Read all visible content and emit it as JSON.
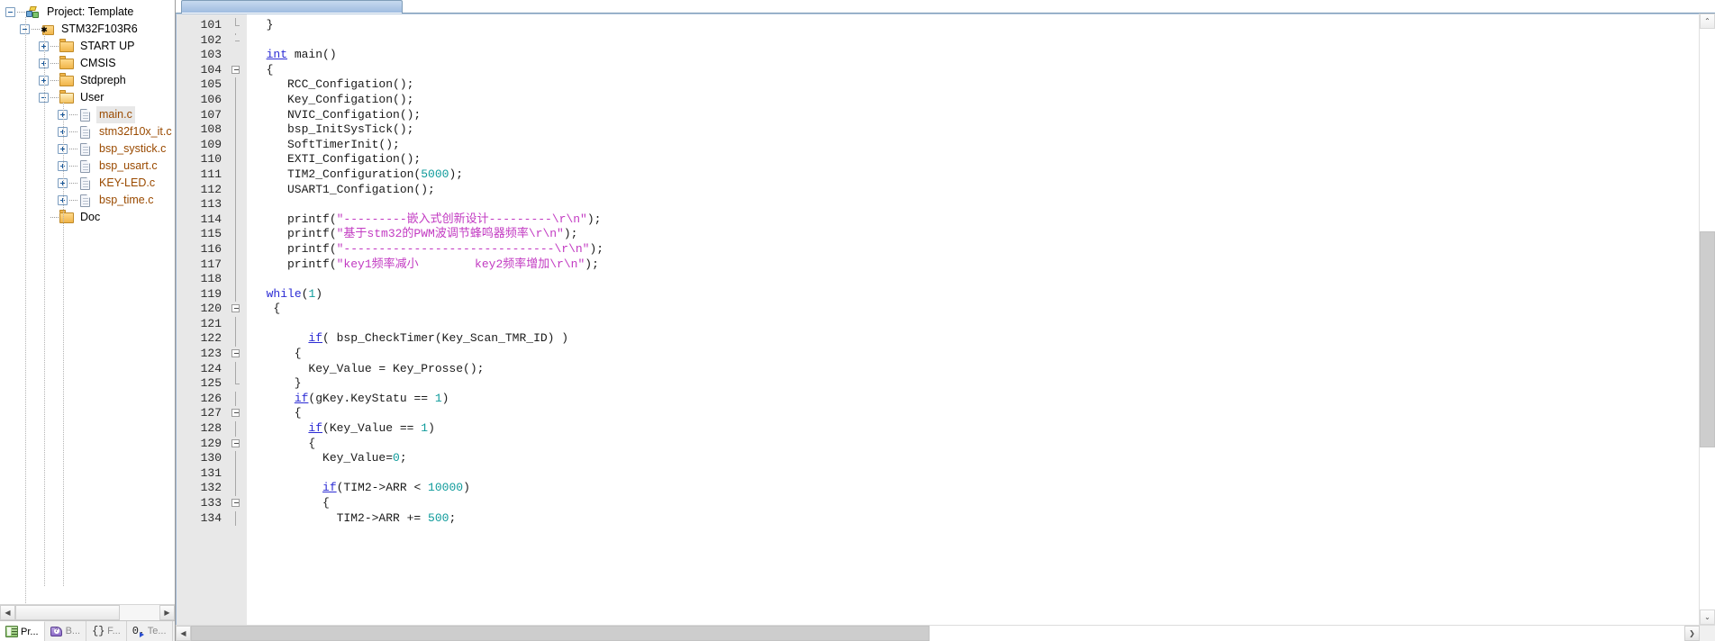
{
  "project_pane": {
    "tree": [
      {
        "depth": 0,
        "type": "project",
        "label": "Project: Template",
        "expander": "minus",
        "selected": false
      },
      {
        "depth": 1,
        "type": "target",
        "label": "STM32F103R6",
        "expander": "minus",
        "selected": false
      },
      {
        "depth": 2,
        "type": "folder",
        "label": "START UP",
        "expander": "plus",
        "selected": false
      },
      {
        "depth": 2,
        "type": "folder",
        "label": "CMSIS",
        "expander": "plus",
        "selected": false
      },
      {
        "depth": 2,
        "type": "folder",
        "label": "Stdpreph",
        "expander": "plus",
        "selected": false
      },
      {
        "depth": 2,
        "type": "folder-open",
        "label": "User",
        "expander": "minus",
        "selected": false
      },
      {
        "depth": 3,
        "type": "file",
        "label": "main.c",
        "expander": "plus",
        "selected": true
      },
      {
        "depth": 3,
        "type": "file",
        "label": "stm32f10x_it.c",
        "expander": "plus",
        "selected": false
      },
      {
        "depth": 3,
        "type": "file",
        "label": "bsp_systick.c",
        "expander": "plus",
        "selected": false
      },
      {
        "depth": 3,
        "type": "file",
        "label": "bsp_usart.c",
        "expander": "plus",
        "selected": false
      },
      {
        "depth": 3,
        "type": "file",
        "label": "KEY-LED.c",
        "expander": "plus",
        "selected": false
      },
      {
        "depth": 3,
        "type": "file",
        "label": "bsp_time.c",
        "expander": "plus",
        "selected": false
      },
      {
        "depth": 2,
        "type": "folder",
        "label": "Doc",
        "expander": "none",
        "selected": false
      }
    ],
    "hscroll": {
      "left_arrow": "◀",
      "right_arrow": "▶"
    },
    "tabs": [
      {
        "label": "Pr...",
        "icon": "project-window-icon",
        "active": true
      },
      {
        "label": "B...",
        "icon": "books-icon",
        "active": false
      },
      {
        "label": "F...",
        "icon": "functions-icon",
        "active": false
      },
      {
        "label": "Te...",
        "icon": "templates-icon",
        "active": false
      }
    ]
  },
  "editor": {
    "first_line": 101,
    "scrollbars": {
      "up_arrow": "⌃",
      "down_arrow": "⌄",
      "right_arrow": "❯"
    },
    "lines": [
      {
        "n": 101,
        "fold": "end",
        "tokens": [
          {
            "t": "  }",
            "c": "plain"
          }
        ]
      },
      {
        "n": 102,
        "fold": "tail",
        "tokens": []
      },
      {
        "n": 103,
        "fold": "none",
        "tokens": [
          {
            "t": "  ",
            "c": "plain"
          },
          {
            "t": "int",
            "c": "kwu"
          },
          {
            "t": " main()",
            "c": "plain"
          }
        ]
      },
      {
        "n": 104,
        "fold": "box",
        "tokens": [
          {
            "t": "  {",
            "c": "plain"
          }
        ]
      },
      {
        "n": 105,
        "fold": "line",
        "tokens": [
          {
            "t": "     RCC_Configation();",
            "c": "plain"
          }
        ]
      },
      {
        "n": 106,
        "fold": "line",
        "tokens": [
          {
            "t": "     Key_Configation();",
            "c": "plain"
          }
        ]
      },
      {
        "n": 107,
        "fold": "line",
        "tokens": [
          {
            "t": "     NVIC_Configation();",
            "c": "plain"
          }
        ]
      },
      {
        "n": 108,
        "fold": "line",
        "tokens": [
          {
            "t": "     bsp_InitSysTick();",
            "c": "plain"
          }
        ]
      },
      {
        "n": 109,
        "fold": "line",
        "tokens": [
          {
            "t": "     SoftTimerInit();",
            "c": "plain"
          }
        ]
      },
      {
        "n": 110,
        "fold": "line",
        "tokens": [
          {
            "t": "     EXTI_Configation();",
            "c": "plain"
          }
        ]
      },
      {
        "n": 111,
        "fold": "line",
        "tokens": [
          {
            "t": "     TIM2_Configuration(",
            "c": "plain"
          },
          {
            "t": "5000",
            "c": "num"
          },
          {
            "t": ");",
            "c": "plain"
          }
        ]
      },
      {
        "n": 112,
        "fold": "line",
        "tokens": [
          {
            "t": "     USART1_Configation();",
            "c": "plain"
          }
        ]
      },
      {
        "n": 113,
        "fold": "line",
        "tokens": []
      },
      {
        "n": 114,
        "fold": "line",
        "tokens": [
          {
            "t": "     printf(",
            "c": "plain"
          },
          {
            "t": "\"---------嵌入式创新设计---------\\r\\n\"",
            "c": "str"
          },
          {
            "t": ");",
            "c": "plain"
          }
        ]
      },
      {
        "n": 115,
        "fold": "line",
        "tokens": [
          {
            "t": "     printf(",
            "c": "plain"
          },
          {
            "t": "\"基于stm32的PWM波调节蜂鸣器频率\\r\\n\"",
            "c": "str"
          },
          {
            "t": ");",
            "c": "plain"
          }
        ]
      },
      {
        "n": 116,
        "fold": "line",
        "tokens": [
          {
            "t": "     printf(",
            "c": "plain"
          },
          {
            "t": "\"------------------------------\\r\\n\"",
            "c": "str"
          },
          {
            "t": ");",
            "c": "plain"
          }
        ]
      },
      {
        "n": 117,
        "fold": "line",
        "tokens": [
          {
            "t": "     printf(",
            "c": "plain"
          },
          {
            "t": "\"key1频率减小        key2频率增加\\r\\n\"",
            "c": "str"
          },
          {
            "t": ");",
            "c": "plain"
          }
        ]
      },
      {
        "n": 118,
        "fold": "line",
        "tokens": []
      },
      {
        "n": 119,
        "fold": "line",
        "tokens": [
          {
            "t": "  ",
            "c": "plain"
          },
          {
            "t": "while",
            "c": "kw"
          },
          {
            "t": "(",
            "c": "plain"
          },
          {
            "t": "1",
            "c": "num"
          },
          {
            "t": ")",
            "c": "plain"
          }
        ]
      },
      {
        "n": 120,
        "fold": "box",
        "tokens": [
          {
            "t": "   {",
            "c": "plain"
          }
        ]
      },
      {
        "n": 121,
        "fold": "line",
        "tokens": []
      },
      {
        "n": 122,
        "fold": "line",
        "tokens": [
          {
            "t": "        ",
            "c": "plain"
          },
          {
            "t": "if",
            "c": "kwu"
          },
          {
            "t": "( bsp_CheckTimer(Key_Scan_TMR_ID) )",
            "c": "plain"
          }
        ]
      },
      {
        "n": 123,
        "fold": "box",
        "tokens": [
          {
            "t": "      {",
            "c": "plain"
          }
        ]
      },
      {
        "n": 124,
        "fold": "line",
        "tokens": [
          {
            "t": "        Key_Value = Key_Prosse();",
            "c": "plain"
          }
        ]
      },
      {
        "n": 125,
        "fold": "end",
        "tokens": [
          {
            "t": "      }",
            "c": "plain"
          }
        ]
      },
      {
        "n": 126,
        "fold": "line",
        "tokens": [
          {
            "t": "      ",
            "c": "plain"
          },
          {
            "t": "if",
            "c": "kwu"
          },
          {
            "t": "(gKey.KeyStatu == ",
            "c": "plain"
          },
          {
            "t": "1",
            "c": "num"
          },
          {
            "t": ")",
            "c": "plain"
          }
        ]
      },
      {
        "n": 127,
        "fold": "box",
        "tokens": [
          {
            "t": "      {",
            "c": "plain"
          }
        ]
      },
      {
        "n": 128,
        "fold": "line",
        "tokens": [
          {
            "t": "        ",
            "c": "plain"
          },
          {
            "t": "if",
            "c": "kwu"
          },
          {
            "t": "(Key_Value == ",
            "c": "plain"
          },
          {
            "t": "1",
            "c": "num"
          },
          {
            "t": ")",
            "c": "plain"
          }
        ]
      },
      {
        "n": 129,
        "fold": "box",
        "tokens": [
          {
            "t": "        {",
            "c": "plain"
          }
        ]
      },
      {
        "n": 130,
        "fold": "line",
        "tokens": [
          {
            "t": "          Key_Value=",
            "c": "plain"
          },
          {
            "t": "0",
            "c": "num"
          },
          {
            "t": ";",
            "c": "plain"
          }
        ]
      },
      {
        "n": 131,
        "fold": "line",
        "tokens": []
      },
      {
        "n": 132,
        "fold": "line",
        "tokens": [
          {
            "t": "          ",
            "c": "plain"
          },
          {
            "t": "if",
            "c": "kwu"
          },
          {
            "t": "(TIM2->ARR < ",
            "c": "plain"
          },
          {
            "t": "10000",
            "c": "num"
          },
          {
            "t": ")",
            "c": "plain"
          }
        ]
      },
      {
        "n": 133,
        "fold": "box",
        "tokens": [
          {
            "t": "          {",
            "c": "plain"
          }
        ]
      },
      {
        "n": 134,
        "fold": "line",
        "tokens": [
          {
            "t": "            TIM2->ARR += ",
            "c": "plain"
          },
          {
            "t": "500",
            "c": "num"
          },
          {
            "t": ";",
            "c": "plain"
          }
        ]
      }
    ]
  },
  "colors": {
    "keyword": "#2b2bd4",
    "number": "#0f9b9b",
    "string": "#c23ac2",
    "gutter_bg": "#e8e8e8",
    "tab_blue": "#9fbce0",
    "file_label": "#9a4a00"
  }
}
